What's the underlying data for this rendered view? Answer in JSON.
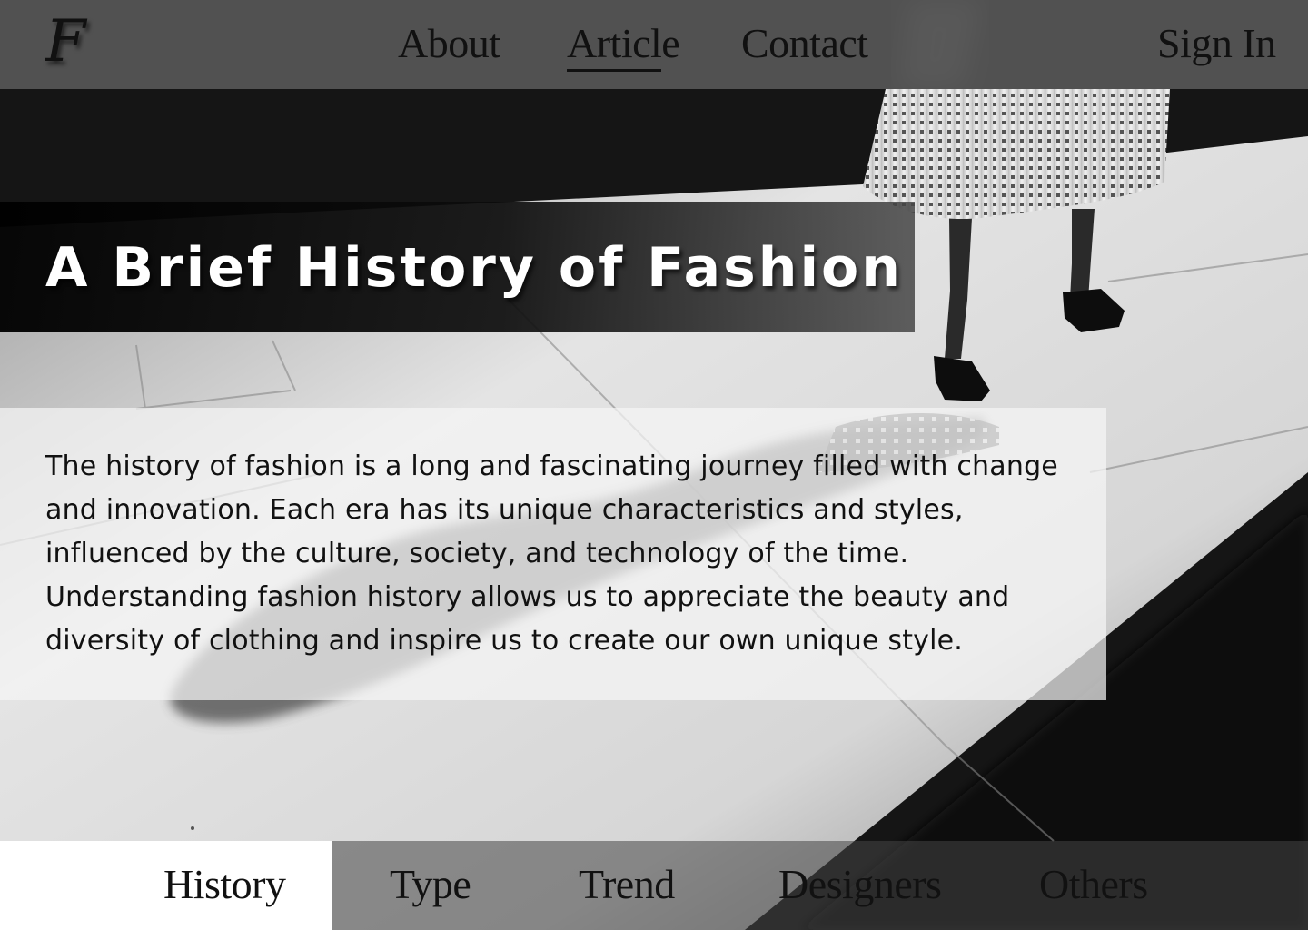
{
  "header": {
    "logo_text": "F",
    "nav": [
      {
        "label": "About",
        "active": false
      },
      {
        "label": "Article",
        "active": true
      },
      {
        "label": "Contact",
        "active": false
      }
    ],
    "sign_in_label": "Sign In"
  },
  "hero": {
    "title": "A Brief History of Fashion",
    "intro": "The history of fashion is a long and fascinating journey filled with change and innovation. Each era has its unique characteristics and styles, influenced by the culture, society, and technology of the time. Understanding fashion history allows us to appreciate the beauty and diversity of clothing and inspire us to create our own unique style."
  },
  "category_tabs": [
    {
      "label": "History",
      "active": true
    },
    {
      "label": "Type",
      "active": false
    },
    {
      "label": "Trend",
      "active": false
    },
    {
      "label": "Designers",
      "active": false
    },
    {
      "label": "Others",
      "active": false
    }
  ],
  "colors": {
    "text_dark": "#111111",
    "title_text": "#ffffff",
    "active_tab_bg": "#ffffff"
  }
}
